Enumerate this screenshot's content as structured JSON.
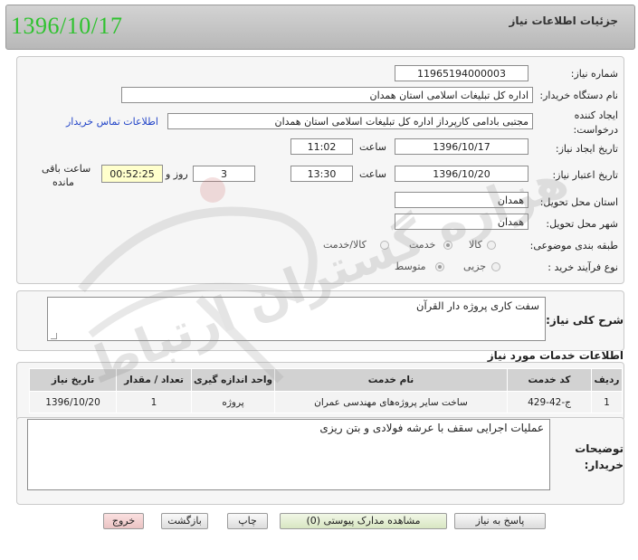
{
  "stamp_date": "1396/10/17",
  "header_title": "جزئیات اطلاعات نیاز",
  "labels": {
    "need_number": "شماره نیاز:",
    "buyer_org": "نام دستگاه خریدار:",
    "creator_line1": "ایجاد کننده",
    "creator_line2": "درخواست:",
    "announce_date": "تاریخ ایجاد نیاز:",
    "valid_date": "تاریخ اعتبار نیاز:",
    "time": "ساعت",
    "days_and": "روز و",
    "remaining_line1": "ساعت باقی",
    "remaining_line2": "مانده",
    "province": "استان محل تحویل:",
    "city": "شهر محل تحویل:",
    "category": "طبقه بندی موضوعی:",
    "process_type": "نوع فرآیند خرید :"
  },
  "values": {
    "need_number": "11965194000003",
    "buyer_org": "اداره کل تبلیغات اسلامی استان همدان",
    "creator": "مجتبی بادامی کارپرداز اداره کل تبلیغات اسلامی استان همدان",
    "contact_link": "اطلاعات تماس خریدار",
    "announce_date": "1396/10/17",
    "announce_time": "11:02",
    "valid_date": "1396/10/20",
    "valid_time": "13:30",
    "days": "3",
    "remaining_time": "00:52:25",
    "province": "همدان",
    "city": "همدان"
  },
  "category_options": [
    {
      "label": "کالا",
      "selected": false
    },
    {
      "label": "خدمت",
      "selected": true
    },
    {
      "label": "کالا/خدمت",
      "selected": false
    }
  ],
  "process_options": [
    {
      "label": "جزیی",
      "selected": false
    },
    {
      "label": "متوسط",
      "selected": true
    }
  ],
  "description": {
    "label": "شرح کلی نیاز:",
    "text": "سفت کاری پروژه  دار القرآن"
  },
  "services": {
    "title": "اطلاعات خدمات مورد نیاز",
    "headers": [
      "ردیف",
      "کد خدمت",
      "نام خدمت",
      "واحد اندازه گیری",
      "تعداد / مقدار",
      "تاریخ نیاز"
    ],
    "rows": [
      [
        "1",
        "ج-42-429",
        "ساخت سایر پروژه‌های مهندسی عمران",
        "پروژه",
        "1",
        "1396/10/20"
      ]
    ]
  },
  "buyer_notes": {
    "label_line1": "توضیحات",
    "label_line2": "خریدار:",
    "text": "عملیات اجرایی سقف با عرشه فولادی و بتن ریزی"
  },
  "buttons": {
    "reply": "پاسخ به نیاز",
    "attachments": "مشاهده مدارک پیوستی (0)",
    "print": "چاپ",
    "back": "بازگشت",
    "exit": "خروج"
  },
  "watermark": "هزاره گستران ارتباط"
}
